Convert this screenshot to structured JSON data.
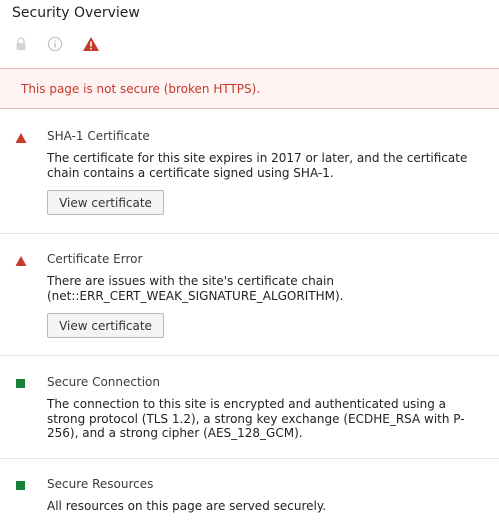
{
  "panel": {
    "title": "Security Overview"
  },
  "tabs": [
    {
      "icon": "lock-icon"
    },
    {
      "icon": "info-icon"
    },
    {
      "icon": "warning-icon",
      "color": "#c6392b"
    }
  ],
  "banner": {
    "text": "This page is not secure (broken HTTPS).",
    "color": "#c6392b"
  },
  "sections": [
    {
      "status": "warning",
      "icon": "warning-triangle-icon",
      "title": "SHA-1 Certificate",
      "description": "The certificate for this site expires in 2017 or later, and the certificate chain contains a certificate signed using SHA-1.",
      "button": "View certificate"
    },
    {
      "status": "warning",
      "icon": "warning-triangle-icon",
      "title": "Certificate Error",
      "description": "There are issues with the site's certificate chain (net::ERR_CERT_WEAK_SIGNATURE_ALGORITHM).",
      "button": "View certificate"
    },
    {
      "status": "secure",
      "icon": "green-square-icon",
      "title": "Secure Connection",
      "description": "The connection to this site is encrypted and authenticated using a strong protocol (TLS 1.2), a strong key exchange (ECDHE_RSA with P-256), and a strong cipher (AES_128_GCM)."
    },
    {
      "status": "secure",
      "icon": "green-square-icon",
      "title": "Secure Resources",
      "description": "All resources on this page are served securely."
    }
  ],
  "colors": {
    "warning": "#c6392b",
    "secure": "#188038"
  }
}
